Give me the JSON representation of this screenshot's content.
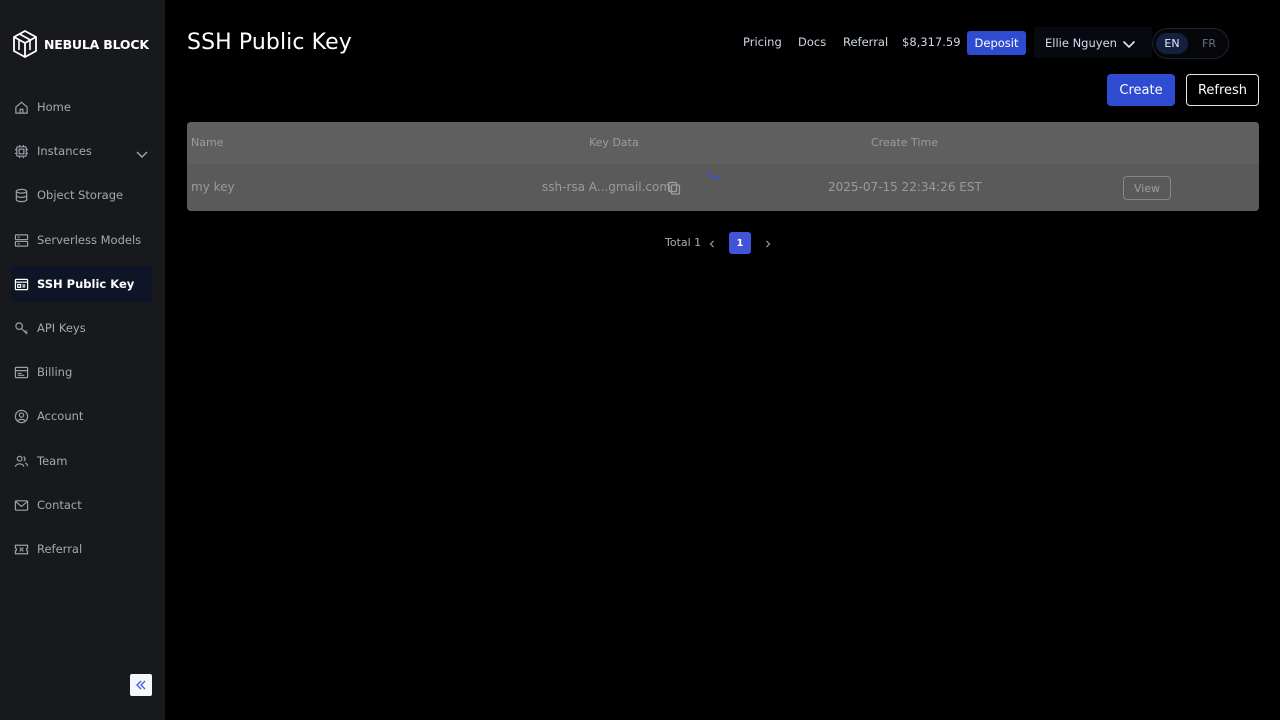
{
  "brand": {
    "name": "NEBULA BLOCK"
  },
  "sidebar": {
    "items": [
      {
        "label": "Home",
        "icon": "home-icon"
      },
      {
        "label": "Instances",
        "icon": "chip-icon"
      },
      {
        "label": "Object Storage",
        "icon": "database-icon"
      },
      {
        "label": "Serverless Models",
        "icon": "server-icon"
      },
      {
        "label": "SSH Public Key",
        "icon": "ssh-key-icon",
        "active": true
      },
      {
        "label": "API Keys",
        "icon": "key-icon"
      },
      {
        "label": "Billing",
        "icon": "billing-icon"
      },
      {
        "label": "Account",
        "icon": "account-icon"
      },
      {
        "label": "Team",
        "icon": "team-icon"
      },
      {
        "label": "Contact",
        "icon": "mail-icon"
      },
      {
        "label": "Referral",
        "icon": "ticket-icon"
      }
    ]
  },
  "header": {
    "title": "SSH Public Key",
    "links": {
      "pricing": "Pricing",
      "docs": "Docs",
      "referral": "Referral"
    },
    "balance": "$8,317.59",
    "deposit_label": "Deposit",
    "user_name": "Ellie Nguyen",
    "languages": {
      "en": "EN",
      "fr": "FR"
    },
    "active_language": "EN"
  },
  "actions": {
    "create_label": "Create",
    "refresh_label": "Refresh"
  },
  "table": {
    "columns": {
      "name": "Name",
      "key_data": "Key Data",
      "create_time": "Create Time"
    },
    "rows": [
      {
        "name": "my key",
        "key_data": "ssh-rsa A...gmail.com",
        "create_time": "2025-07-15 22:34:26 EST",
        "action_label": "View"
      }
    ]
  },
  "pagination": {
    "total_label": "Total 1",
    "current_page": "1"
  },
  "colors": {
    "accent": "#2e4bd1",
    "page_bg": "#000000",
    "sidebar_bg": "#17191c",
    "table_overlay": "#5a5a5a"
  }
}
